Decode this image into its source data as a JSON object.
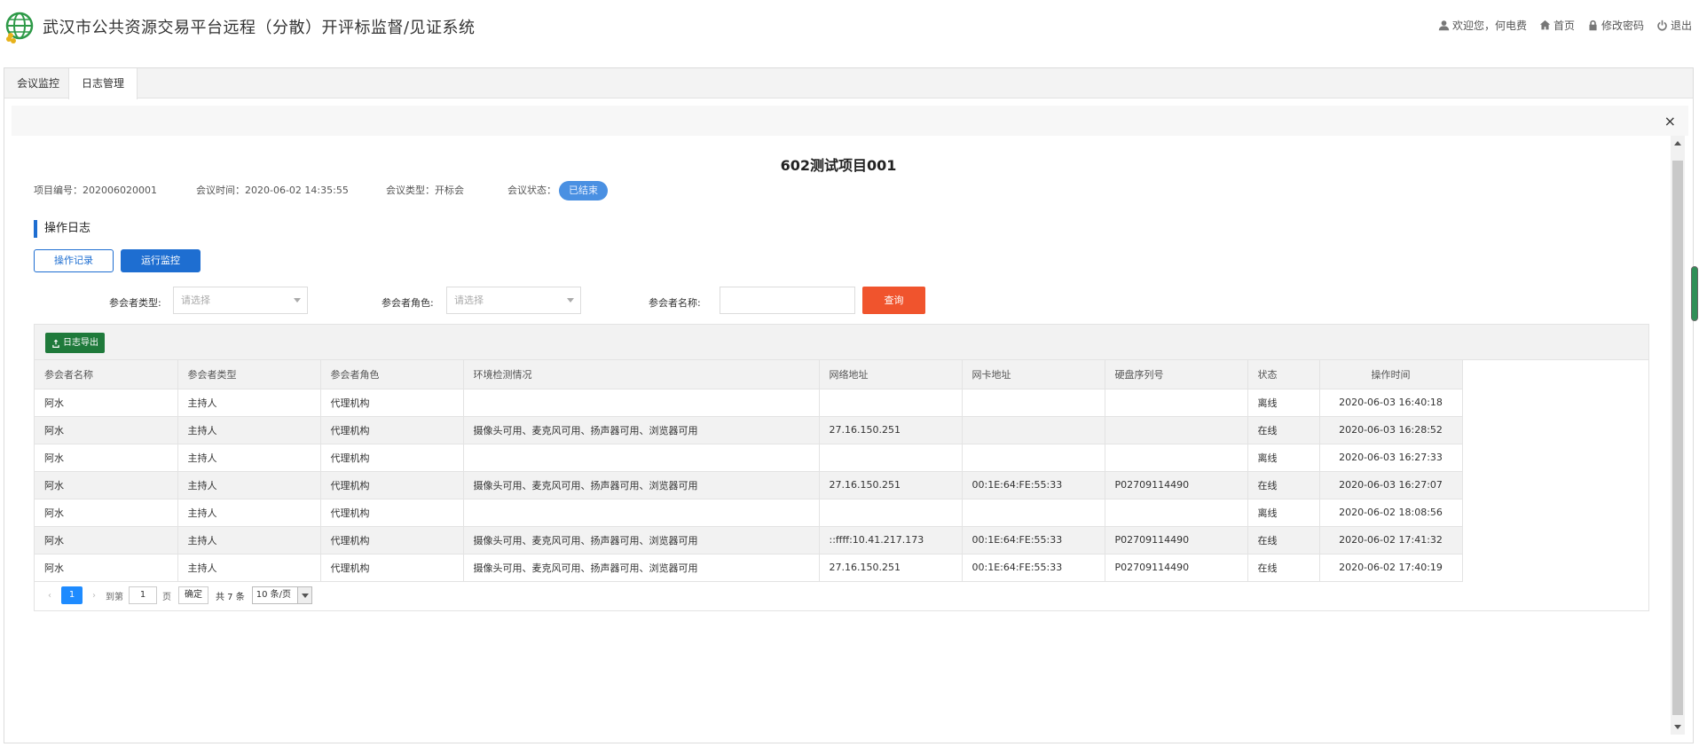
{
  "header": {
    "title": "武汉市公共资源交易平台远程（分散）开评标监督/见证系统",
    "welcome": "欢迎您，何电费",
    "home": "首页",
    "change_password": "修改密码",
    "logout": "退出"
  },
  "tabs": [
    {
      "label": "会议监控"
    },
    {
      "label": "日志管理"
    }
  ],
  "project": {
    "title": "602测试项目001",
    "code": "项目编号：202006020001",
    "time": "会议时间：2020-06-02 14:35:55",
    "type": "会议类型：开标会",
    "status_label": "会议状态：",
    "status_value": "已结束"
  },
  "section": {
    "title": "操作日志",
    "btn_records": "操作记录",
    "btn_monitor": "运行监控"
  },
  "filters": {
    "type_label": "参会者类型:",
    "type_placeholder": "请选择",
    "role_label": "参会者角色:",
    "role_placeholder": "请选择",
    "name_label": "参会者名称:",
    "name_value": "",
    "query": "查询"
  },
  "toolbar": {
    "export": "日志导出"
  },
  "table": {
    "columns": [
      "参会者名称",
      "参会者类型",
      "参会者角色",
      "环境检测情况",
      "网络地址",
      "网卡地址",
      "硬盘序列号",
      "状态",
      "操作时间"
    ],
    "rows": [
      [
        "阿水",
        "主持人",
        "代理机构",
        "",
        "",
        "",
        "",
        "离线",
        "2020-06-03 16:40:18"
      ],
      [
        "阿水",
        "主持人",
        "代理机构",
        "摄像头可用、麦克风可用、扬声器可用、浏览器可用",
        "27.16.150.251",
        "",
        "",
        "在线",
        "2020-06-03 16:28:52"
      ],
      [
        "阿水",
        "主持人",
        "代理机构",
        "",
        "",
        "",
        "",
        "离线",
        "2020-06-03 16:27:33"
      ],
      [
        "阿水",
        "主持人",
        "代理机构",
        "摄像头可用、麦克风可用、扬声器可用、浏览器可用",
        "27.16.150.251",
        "00:1E:64:FE:55:33",
        "P02709114490",
        "在线",
        "2020-06-03 16:27:07"
      ],
      [
        "阿水",
        "主持人",
        "代理机构",
        "",
        "",
        "",
        "",
        "离线",
        "2020-06-02 18:08:56"
      ],
      [
        "阿水",
        "主持人",
        "代理机构",
        "摄像头可用、麦克风可用、扬声器可用、浏览器可用",
        "::ffff:10.41.217.173",
        "00:1E:64:FE:55:33",
        "P02709114490",
        "在线",
        "2020-06-02 17:41:32"
      ],
      [
        "阿水",
        "主持人",
        "代理机构",
        "摄像头可用、麦克风可用、扬声器可用、浏览器可用",
        "27.16.150.251",
        "00:1E:64:FE:55:33",
        "P02709114490",
        "在线",
        "2020-06-02 17:40:19"
      ]
    ]
  },
  "pager": {
    "current": "1",
    "goto_label": "到第",
    "goto_value": "1",
    "page_unit": "页",
    "confirm": "确定",
    "total": "共 7 条",
    "page_size": "10 条/页"
  },
  "close_symbol": "×"
}
